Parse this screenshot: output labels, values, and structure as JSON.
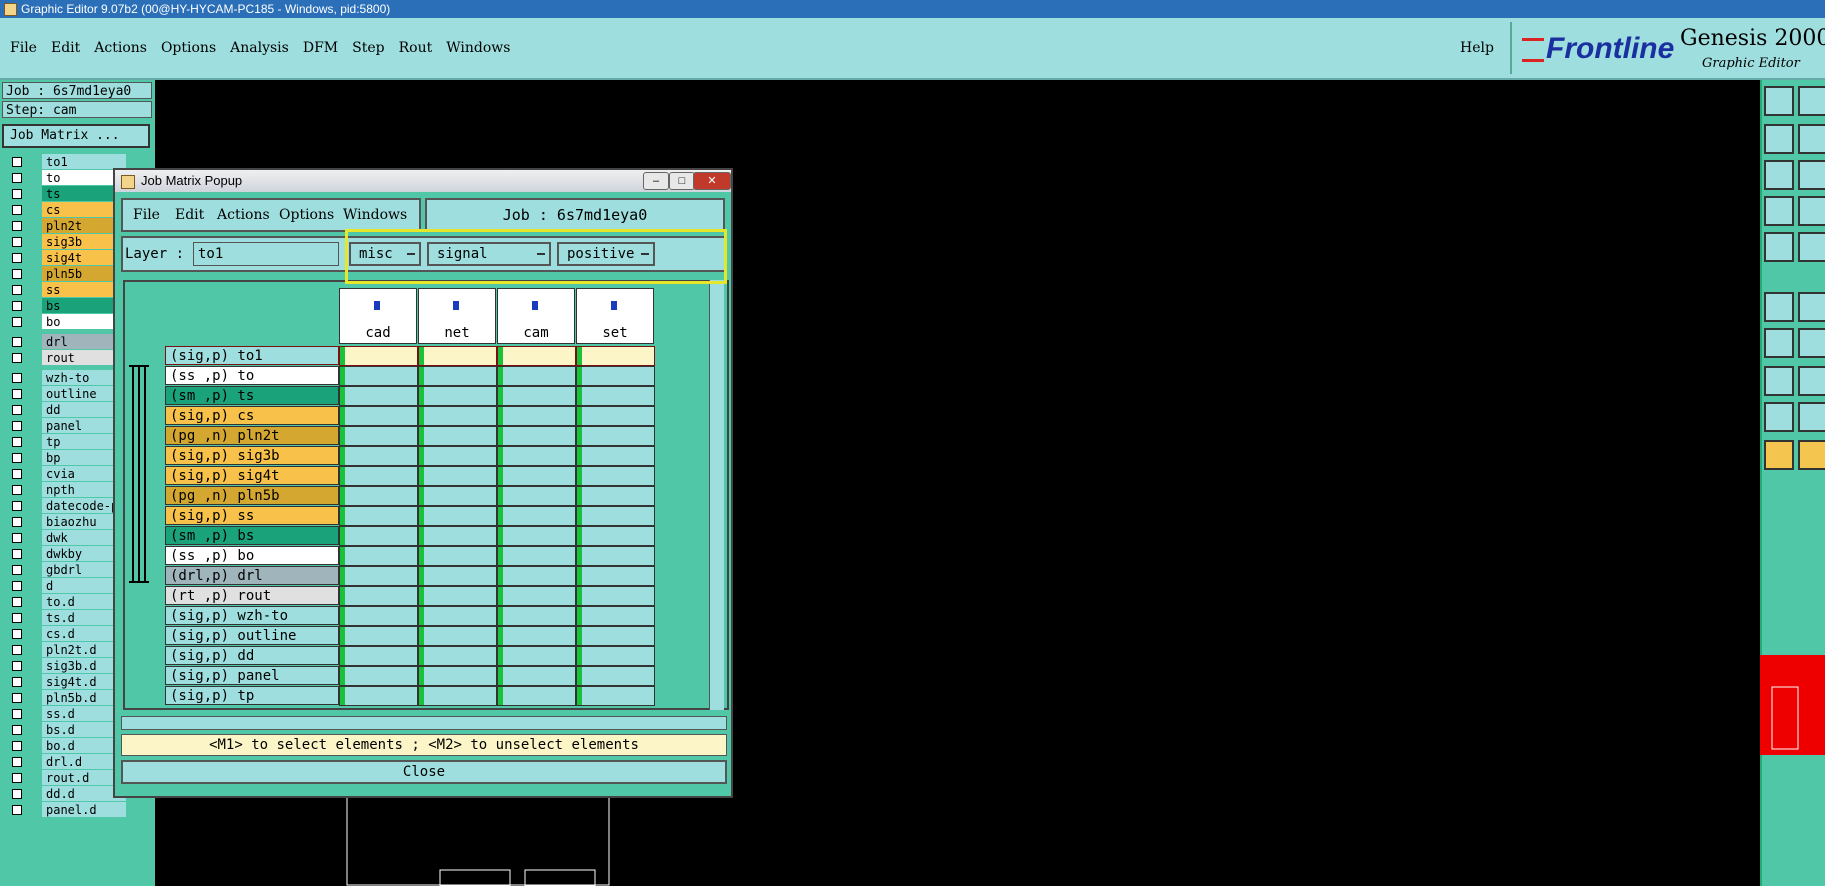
{
  "window_title": "Graphic Editor 9.07b2 (00@HY-HYCAM-PC185 - Windows, pid:5800)",
  "main_menu": [
    "File",
    "Edit",
    "Actions",
    "Options",
    "Analysis",
    "DFM",
    "Step",
    "Rout",
    "Windows"
  ],
  "help": "Help",
  "brand": {
    "logo": "Frontline",
    "product": "Genesis 2000",
    "subtitle": "Graphic Editor"
  },
  "left_panel": {
    "job": "Job : 6s7md1eya0",
    "step": "Step: cam",
    "job_matrix_button": "Job Matrix ...",
    "layers": [
      {
        "name": "to1",
        "color": "#9fdede"
      },
      {
        "name": "to",
        "color": "#ffffff"
      },
      {
        "name": "ts",
        "color": "#1aa37a"
      },
      {
        "name": "cs",
        "color": "#f7c14a"
      },
      {
        "name": "pln2t",
        "color": "#d4a830"
      },
      {
        "name": "sig3b",
        "color": "#f7c14a"
      },
      {
        "name": "sig4t",
        "color": "#f7c14a"
      },
      {
        "name": "pln5b",
        "color": "#d4a830"
      },
      {
        "name": "ss",
        "color": "#f7c14a"
      },
      {
        "name": "bs",
        "color": "#1aa37a"
      },
      {
        "name": "bo",
        "color": "#ffffff"
      },
      {
        "name": "drl",
        "color": "#a0b4bc"
      },
      {
        "name": "rout",
        "color": "#e0e0e0"
      },
      {
        "name": "wzh-to",
        "color": "#9fdede"
      },
      {
        "name": "outline",
        "color": "#9fdede"
      },
      {
        "name": "dd",
        "color": "#9fdede"
      },
      {
        "name": "panel",
        "color": "#9fdede"
      },
      {
        "name": "tp",
        "color": "#9fdede"
      },
      {
        "name": "bp",
        "color": "#9fdede"
      },
      {
        "name": "cvia",
        "color": "#9fdede"
      },
      {
        "name": "npth",
        "color": "#9fdede"
      },
      {
        "name": "datecode-p",
        "color": "#9fdede"
      },
      {
        "name": "biaozhu",
        "color": "#9fdede"
      },
      {
        "name": "dwk",
        "color": "#9fdede"
      },
      {
        "name": "dwkby",
        "color": "#9fdede"
      },
      {
        "name": "gbdrl",
        "color": "#9fdede"
      },
      {
        "name": "d",
        "color": "#9fdede"
      },
      {
        "name": "to.d",
        "color": "#9fdede"
      },
      {
        "name": "ts.d",
        "color": "#9fdede"
      },
      {
        "name": "cs.d",
        "color": "#9fdede"
      },
      {
        "name": "pln2t.d",
        "color": "#9fdede"
      },
      {
        "name": "sig3b.d",
        "color": "#9fdede"
      },
      {
        "name": "sig4t.d",
        "color": "#9fdede"
      },
      {
        "name": "pln5b.d",
        "color": "#9fdede"
      },
      {
        "name": "ss.d",
        "color": "#9fdede"
      },
      {
        "name": "bs.d",
        "color": "#9fdede"
      },
      {
        "name": "bo.d",
        "color": "#9fdede"
      },
      {
        "name": "drl.d",
        "color": "#9fdede"
      },
      {
        "name": "rout.d",
        "color": "#9fdede"
      },
      {
        "name": "dd.d",
        "color": "#9fdede"
      },
      {
        "name": "panel.d",
        "color": "#9fdede"
      }
    ]
  },
  "popup": {
    "title": "Job Matrix Popup",
    "menu": [
      "File",
      "Edit",
      "Actions",
      "Options",
      "Windows"
    ],
    "job_label": "Job : 6s7md1eya0",
    "layer_label": "Layer :",
    "layer_value": "to1",
    "dropdowns": [
      "misc",
      "signal",
      "positive"
    ],
    "steps": [
      "cad",
      "net",
      "cam",
      "set"
    ],
    "rows": [
      {
        "label": "(sig,p) to1",
        "color": "#9fdede",
        "selected": true
      },
      {
        "label": "(ss ,p) to",
        "color": "#ffffff"
      },
      {
        "label": "(sm ,p) ts",
        "color": "#1aa37a"
      },
      {
        "label": "(sig,p) cs",
        "color": "#f7c14a"
      },
      {
        "label": "(pg ,n) pln2t",
        "color": "#d4a830"
      },
      {
        "label": "(sig,p) sig3b",
        "color": "#f7c14a"
      },
      {
        "label": "(sig,p) sig4t",
        "color": "#f7c14a"
      },
      {
        "label": "(pg ,n) pln5b",
        "color": "#d4a830"
      },
      {
        "label": "(sig,p) ss",
        "color": "#f7c14a"
      },
      {
        "label": "(sm ,p) bs",
        "color": "#1aa37a"
      },
      {
        "label": "(ss ,p) bo",
        "color": "#ffffff"
      },
      {
        "label": "(drl,p) drl",
        "color": "#a0b4bc"
      },
      {
        "label": "(rt ,p) rout",
        "color": "#e0e0e0"
      },
      {
        "label": "(sig,p) wzh-to",
        "color": "#9fdede"
      },
      {
        "label": "(sig,p) outline",
        "color": "#9fdede"
      },
      {
        "label": "(sig,p) dd",
        "color": "#9fdede"
      },
      {
        "label": "(sig,p) panel",
        "color": "#9fdede"
      },
      {
        "label": "(sig,p) tp",
        "color": "#9fdede"
      }
    ],
    "status": "<M1> to select elements ; <M2> to unselect elements",
    "close": "Close"
  }
}
